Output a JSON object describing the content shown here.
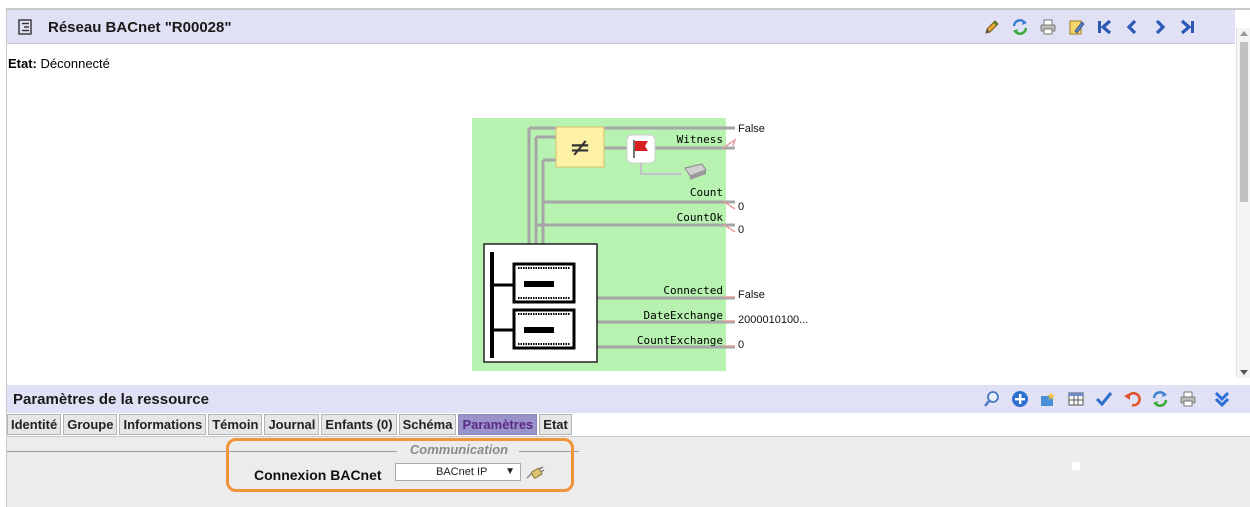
{
  "window": {
    "title": "Réseau BACnet \"R00028\""
  },
  "status": {
    "label": "Etat:",
    "value": "Déconnecté"
  },
  "diagram": {
    "outputs": [
      {
        "name": "Witness",
        "value": "False"
      },
      {
        "name": "Count",
        "value": "0"
      },
      {
        "name": "CountOk",
        "value": "0"
      },
      {
        "name": "Connected",
        "value": "False"
      },
      {
        "name": "DateExchange",
        "value": "2000010100..."
      },
      {
        "name": "CountExchange",
        "value": "0"
      }
    ],
    "not_equal_symbol": "≠",
    "colors": {
      "background": "#b7f2b0",
      "block": "#fdf1a6",
      "line": "#a6a6a6",
      "arrow": "#e89a9a"
    }
  },
  "params_panel": {
    "title": "Paramètres de la ressource",
    "tabs": [
      {
        "label": "Identité",
        "active": false
      },
      {
        "label": "Groupe",
        "active": false
      },
      {
        "label": "Informations",
        "active": false
      },
      {
        "label": "Témoin",
        "active": false
      },
      {
        "label": "Journal",
        "active": false
      },
      {
        "label": "Enfants (0)",
        "active": false
      },
      {
        "label": "Schéma",
        "active": false
      },
      {
        "label": "Paramètres",
        "active": true
      },
      {
        "label": "Etat",
        "active": false
      }
    ],
    "section_legend": "Communication",
    "connection": {
      "label": "Connexion BACnet",
      "selected": "BACnet IP",
      "caret": "▼"
    }
  },
  "icons": {
    "header_toolbar": [
      "pencil-icon",
      "refresh-icon",
      "print-icon",
      "edit-document-icon",
      "first-icon",
      "previous-icon",
      "next-icon",
      "last-icon"
    ],
    "params_toolbar": [
      "search-icon",
      "add-icon",
      "effects-icon",
      "table-icon",
      "validate-icon",
      "undo-icon",
      "refresh-icon",
      "print-icon",
      "collapse-icon"
    ]
  },
  "accent_colors": {
    "header_bg": "#e1e1f6",
    "active_tab": "#9a93c9",
    "highlight": "#f0943a",
    "nav_icons": "#2b59b5"
  }
}
